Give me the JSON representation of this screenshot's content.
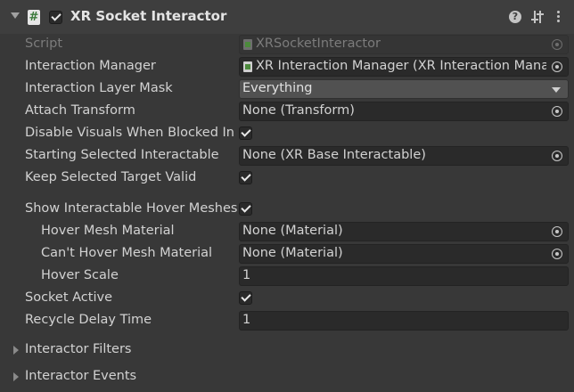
{
  "header": {
    "title": "XR Socket Interactor",
    "script_glyph": "#",
    "help_glyph": "?",
    "enabled": true,
    "icons": [
      "fold-arrow-icon",
      "script-icon",
      "help-icon",
      "presets-icon",
      "kebab-menu-icon"
    ]
  },
  "rows": {
    "script": {
      "label": "Script",
      "value": "XRSocketInteractor"
    },
    "interaction_manager": {
      "label": "Interaction Manager",
      "value": "XR Interaction Manager (XR Interaction Manag"
    },
    "interaction_layer_mask": {
      "label": "Interaction Layer Mask",
      "value": "Everything"
    },
    "attach_transform": {
      "label": "Attach Transform",
      "value": "None (Transform)"
    },
    "disable_visuals": {
      "label": "Disable Visuals When Blocked In",
      "checked": true
    },
    "starting_selected": {
      "label": "Starting Selected Interactable",
      "value": "None (XR Base Interactable)"
    },
    "keep_selected": {
      "label": "Keep Selected Target Valid",
      "checked": true
    },
    "show_hover_meshes": {
      "label": "Show Interactable Hover Meshes",
      "checked": true
    },
    "hover_mesh_material": {
      "label": "Hover Mesh Material",
      "value": "None (Material)"
    },
    "cant_hover_mesh_material": {
      "label": "Can't Hover Mesh Material",
      "value": "None (Material)"
    },
    "hover_scale": {
      "label": "Hover Scale",
      "value": "1"
    },
    "socket_active": {
      "label": "Socket Active",
      "checked": true
    },
    "recycle_delay_time": {
      "label": "Recycle Delay Time",
      "value": "1"
    }
  },
  "sections": {
    "interactor_filters": "Interactor Filters",
    "interactor_events": "Interactor Events"
  },
  "colors": {
    "panel_bg": "#383838",
    "header_bg": "#3e3e3e",
    "field_bg": "#2a2a2a",
    "dropdown_bg": "#515151",
    "text": "#d2d2d2",
    "disabled_text": "#7c7c7c"
  }
}
